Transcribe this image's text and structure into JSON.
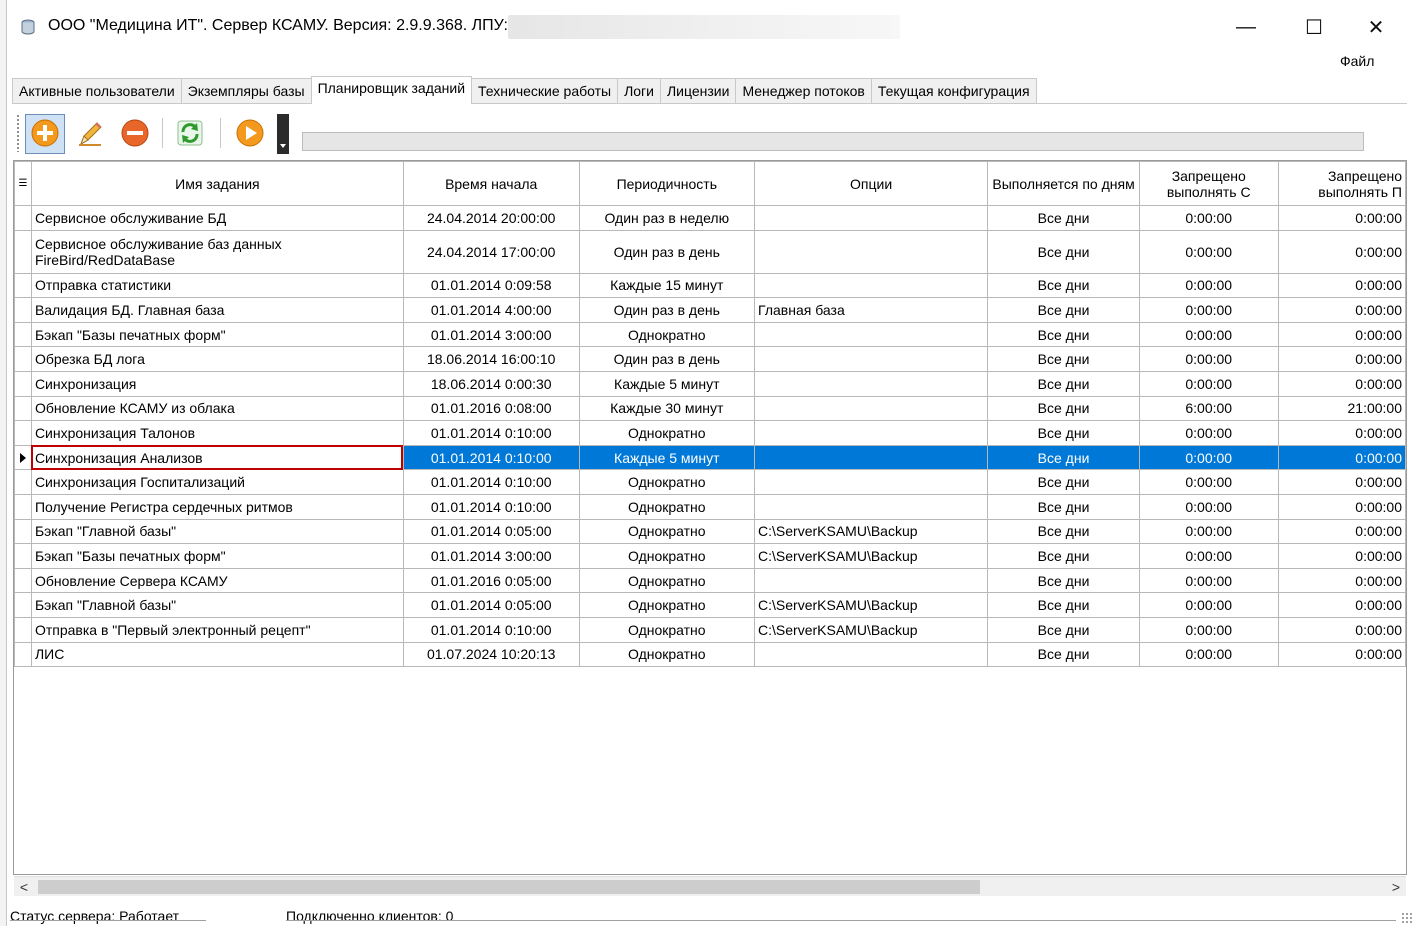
{
  "window": {
    "title": "ООО \"Медицина ИТ\". Сервер КСАМУ. Версия: 2.9.9.368. ЛПУ:",
    "minimize_glyph": "—",
    "maximize_glyph": "☐",
    "close_glyph": "✕"
  },
  "menu": {
    "file": "Файл"
  },
  "tabs": [
    {
      "label": "Активные пользователи"
    },
    {
      "label": "Экземпляры базы"
    },
    {
      "label": "Планировщик заданий",
      "active": true
    },
    {
      "label": "Технические работы"
    },
    {
      "label": "Логи"
    },
    {
      "label": "Лицензии"
    },
    {
      "label": "Менеджер потоков"
    },
    {
      "label": "Текущая конфигурация"
    }
  ],
  "toolbar": {
    "icons": [
      "add-icon",
      "edit-pencil-icon",
      "remove-icon",
      "refresh-icon",
      "run-icon"
    ]
  },
  "grid": {
    "columns": [
      "Имя задания",
      "Время начала",
      "Периодичность",
      "Опции",
      "Выполняется по дням",
      "Запрещено выполнять С",
      "Запрещено выполнять П"
    ],
    "rows": [
      {
        "name": "Сервисное обслуживание БД",
        "start": "24.04.2014 20:00:00",
        "period": "Один раз в неделю",
        "options": "",
        "days": "Все дни",
        "from": "0:00:00",
        "to": "0:00:00"
      },
      {
        "name": "Сервисное обслуживание баз данных FireBird/RedDataBase",
        "start": "24.04.2014 17:00:00",
        "period": "Один раз в день",
        "options": "",
        "days": "Все дни",
        "from": "0:00:00",
        "to": "0:00:00"
      },
      {
        "name": "Отправка статистики",
        "start": "01.01.2014 0:09:58",
        "period": "Каждые 15 минут",
        "options": "",
        "days": "Все дни",
        "from": "0:00:00",
        "to": "0:00:00"
      },
      {
        "name": "Валидация БД. Главная база",
        "start": "01.01.2014 4:00:00",
        "period": "Один раз в день",
        "options": "Главная база",
        "days": "Все дни",
        "from": "0:00:00",
        "to": "0:00:00"
      },
      {
        "name": "Бэкап \"Базы печатных форм\"",
        "start": "01.01.2014 3:00:00",
        "period": "Однократно",
        "options": "",
        "days": "Все дни",
        "from": "0:00:00",
        "to": "0:00:00"
      },
      {
        "name": "Обрезка БД лога",
        "start": "18.06.2014 16:00:10",
        "period": "Один раз в день",
        "options": "",
        "days": "Все дни",
        "from": "0:00:00",
        "to": "0:00:00"
      },
      {
        "name": "Синхронизация",
        "start": "18.06.2014 0:00:30",
        "period": "Каждые 5 минут",
        "options": "",
        "days": "Все дни",
        "from": "0:00:00",
        "to": "0:00:00"
      },
      {
        "name": "Обновление КСАМУ из облака",
        "start": "01.01.2016 0:08:00",
        "period": "Каждые 30 минут",
        "options": "",
        "days": "Все дни",
        "from": "6:00:00",
        "to": "21:00:00"
      },
      {
        "name": "Синхронизация Талонов",
        "start": "01.01.2014 0:10:00",
        "period": "Однократно",
        "options": "",
        "days": "Все дни",
        "from": "0:00:00",
        "to": "0:00:00"
      },
      {
        "name": "Синхронизация Анализов",
        "start": "01.01.2014 0:10:00",
        "period": "Каждые 5 минут",
        "options": "",
        "days": "Все дни",
        "from": "0:00:00",
        "to": "0:00:00",
        "selected": true
      },
      {
        "name": "Синхронизация Госпитализаций",
        "start": "01.01.2014 0:10:00",
        "period": "Однократно",
        "options": "",
        "days": "Все дни",
        "from": "0:00:00",
        "to": "0:00:00"
      },
      {
        "name": "Получение Регистра сердечных ритмов",
        "start": "01.01.2014 0:10:00",
        "period": "Однократно",
        "options": "",
        "days": "Все дни",
        "from": "0:00:00",
        "to": "0:00:00"
      },
      {
        "name": "Бэкап \"Главной базы\"",
        "start": "01.01.2014 0:05:00",
        "period": "Однократно",
        "options": "C:\\ServerKSAMU\\Backup",
        "days": "Все дни",
        "from": "0:00:00",
        "to": "0:00:00"
      },
      {
        "name": "Бэкап \"Базы печатных форм\"",
        "start": "01.01.2014 3:00:00",
        "period": "Однократно",
        "options": "C:\\ServerKSAMU\\Backup",
        "days": "Все дни",
        "from": "0:00:00",
        "to": "0:00:00"
      },
      {
        "name": "Обновление Сервера КСАМУ",
        "start": "01.01.2016 0:05:00",
        "period": "Однократно",
        "options": "",
        "days": "Все дни",
        "from": "0:00:00",
        "to": "0:00:00"
      },
      {
        "name": "Бэкап \"Главной базы\"",
        "start": "01.01.2014 0:05:00",
        "period": "Однократно",
        "options": "C:\\ServerKSAMU\\Backup",
        "days": "Все дни",
        "from": "0:00:00",
        "to": "0:00:00"
      },
      {
        "name": "Отправка в \"Первый электронный рецепт\"",
        "start": "01.01.2014 0:10:00",
        "period": "Однократно",
        "options": "C:\\ServerKSAMU\\Backup",
        "days": "Все дни",
        "from": "0:00:00",
        "to": "0:00:00"
      },
      {
        "name": "ЛИС",
        "start": "01.07.2024 10:20:13",
        "period": "Однократно",
        "options": "",
        "days": "Все дни",
        "from": "0:00:00",
        "to": "0:00:00"
      }
    ]
  },
  "scrollbar": {
    "left_glyph": "<",
    "right_glyph": ">"
  },
  "status": {
    "server": "Статус сервера: Работает",
    "clients": "Подключенно клиентов: 0"
  }
}
